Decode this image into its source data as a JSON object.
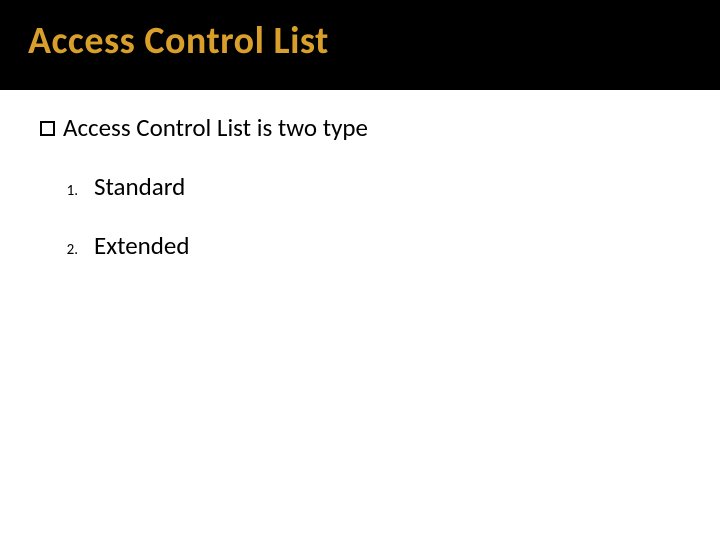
{
  "title": "Access Control List",
  "intro": "Access Control List is two type",
  "items": [
    {
      "num": "1.",
      "label": "Standard"
    },
    {
      "num": "2.",
      "label": "Extended"
    }
  ]
}
